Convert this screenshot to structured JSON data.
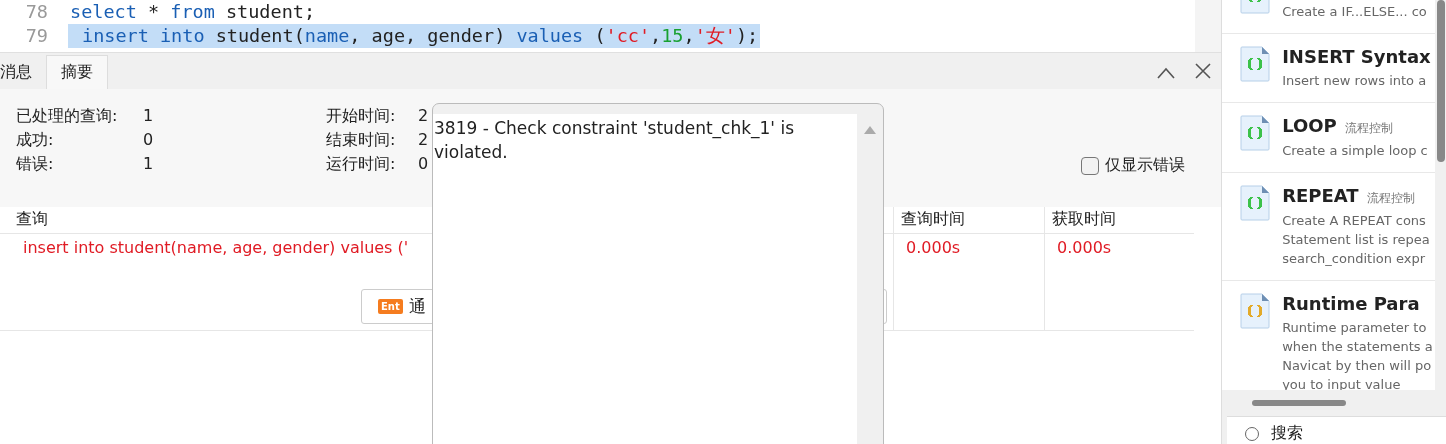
{
  "editor": {
    "lines": [
      {
        "number": "78",
        "selected": false,
        "tokens": [
          {
            "kind": "keyword",
            "text": "select"
          },
          {
            "kind": "plain",
            "text": " * "
          },
          {
            "kind": "keyword",
            "text": "from"
          },
          {
            "kind": "plain",
            "text": " student;"
          }
        ]
      },
      {
        "number": "79",
        "selected": true,
        "tokens": [
          {
            "kind": "keyword",
            "text": "insert"
          },
          {
            "kind": "keyword",
            "text": " into"
          },
          {
            "kind": "plain",
            "text": " student("
          },
          {
            "kind": "keyword",
            "text": "name"
          },
          {
            "kind": "plain",
            "text": ", age, gender) "
          },
          {
            "kind": "keyword",
            "text": "values"
          },
          {
            "kind": "plain",
            "text": " ("
          },
          {
            "kind": "string",
            "text": "'cc'"
          },
          {
            "kind": "plain",
            "text": ","
          },
          {
            "kind": "number",
            "text": "15"
          },
          {
            "kind": "plain",
            "text": ","
          },
          {
            "kind": "string",
            "text": "'女'"
          },
          {
            "kind": "plain",
            "text": ");"
          }
        ]
      }
    ]
  },
  "tabs": [
    {
      "label": "消息",
      "selected": false
    },
    {
      "label": "摘要",
      "selected": true
    }
  ],
  "summary": {
    "left": [
      {
        "label": "已处理的查询:",
        "value": "1"
      },
      {
        "label": "成功:",
        "value": "0"
      },
      {
        "label": "错误:",
        "value": "1"
      }
    ],
    "right": [
      {
        "label": "开始时间:",
        "value": "2"
      },
      {
        "label": "结束时间:",
        "value": "2"
      },
      {
        "label": "运行时间:",
        "value": "0"
      }
    ],
    "errors_only": {
      "label": "仅显示错误",
      "checked": false
    }
  },
  "table": {
    "columns": [
      "查询",
      "查询时间",
      "获取时间"
    ],
    "rows": [
      {
        "query": "insert into student(name, age, gender) values ('",
        "query_time": "0.000s",
        "fetch_time": "0.000s",
        "error": true
      }
    ],
    "button": {
      "badge": "Ent",
      "label": "通"
    }
  },
  "popup": {
    "message": "3819 - Check constraint 'student_chk_1' is violated."
  },
  "snippets": {
    "items": [
      {
        "lines": [
          "Create a IF...ELSE... co"
        ],
        "color": "#3cc24a"
      },
      {
        "title": "INSERT Syntax",
        "lines": [
          "Insert new rows into a"
        ],
        "color": "#3cc24a"
      },
      {
        "title": "LOOP",
        "tag": "流程控制",
        "lines": [
          "Create a simple loop c"
        ],
        "color": "#3cc24a"
      },
      {
        "title": "REPEAT",
        "tag": "流程控制",
        "lines": [
          "Create A REPEAT cons",
          "Statement list is repea",
          "search_condition expr"
        ],
        "color": "#3cc24a"
      },
      {
        "title": "Runtime Para",
        "lines": [
          "Runtime parameter to",
          "when the statements a",
          "Navicat by then will po",
          "you to input value"
        ],
        "color": "#e3aa2a"
      }
    ],
    "search": {
      "label": "搜索",
      "selected": false
    }
  }
}
